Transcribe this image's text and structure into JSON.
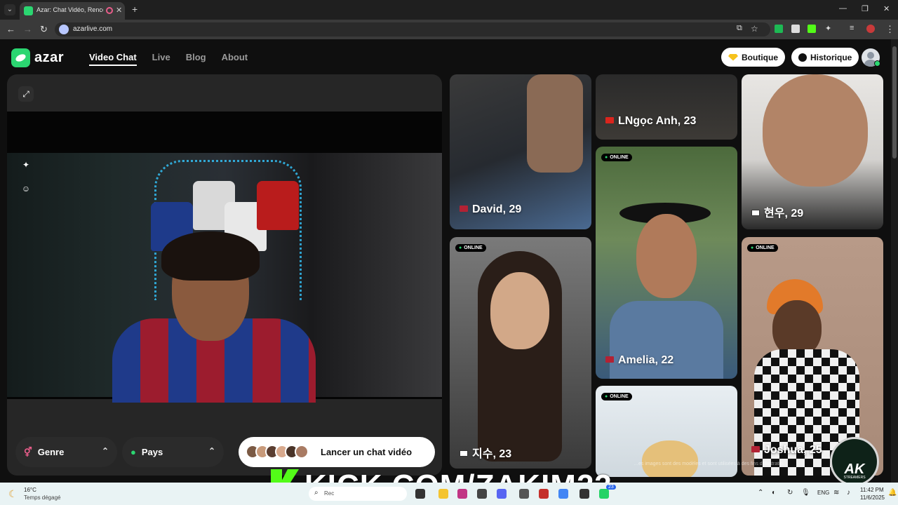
{
  "browser": {
    "tab_title": "Azar: Chat Vidéo, Rencontre",
    "url": "azarlive.com",
    "new_tab": "+",
    "window_controls": [
      "—",
      "❐",
      "✕"
    ]
  },
  "header": {
    "logo": "azar",
    "nav": [
      {
        "label": "Video Chat",
        "active": true
      },
      {
        "label": "Live",
        "active": false
      },
      {
        "label": "Blog",
        "active": false
      },
      {
        "label": "About",
        "active": false
      }
    ],
    "shop_label": "Boutique",
    "history_label": "Historique"
  },
  "video": {
    "filter_gender": "Genre",
    "filter_country": "Pays",
    "launch_label": "Lancer un chat vidéo"
  },
  "cards": [
    {
      "name": "David, 29",
      "online": false,
      "flag": "us"
    },
    {
      "name": "LNgọc Anh, 23",
      "online": false,
      "flag": "vn"
    },
    {
      "name": "현우, 29",
      "online": false,
      "flag": "kr"
    },
    {
      "name": "Amelia, 22",
      "online": true,
      "flag": "us"
    },
    {
      "name": "지수, 23",
      "online": true,
      "flag": "kr"
    },
    {
      "name": "Joshua, 25",
      "online": true,
      "flag": "us"
    },
    {
      "name": "",
      "online": true,
      "flag": ""
    }
  ],
  "online_label": "ONLINE",
  "disclaimer": "…es images sont des modèles et sont utilisées à des fins d'illustratio…",
  "overlay": {
    "stream": "KICK.COM/ZAKIM23",
    "badge_main": "AK",
    "badge_sub": "STREAMERS"
  },
  "taskbar": {
    "weather_temp": "16°C",
    "weather_desc": "Temps dégagé",
    "search_text": "Rec",
    "language": "ENG",
    "time": "11:42 PM",
    "date": "11/6/2025",
    "badge_count": "23"
  }
}
